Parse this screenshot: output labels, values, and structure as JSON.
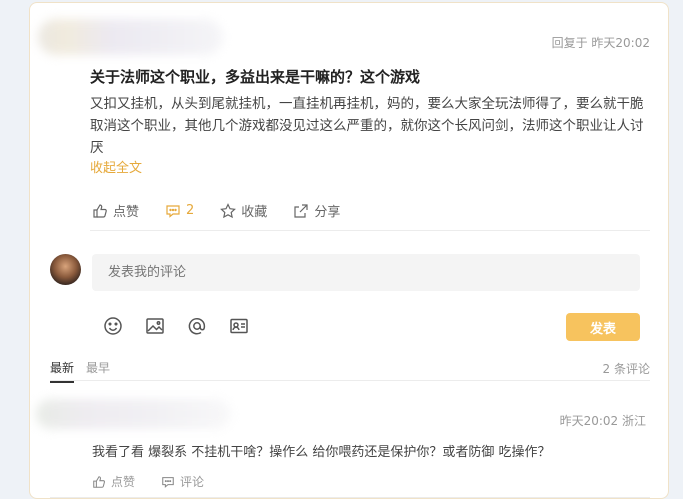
{
  "post": {
    "reply_meta": "回复于  昨天20:02",
    "title": "关于法师这个职业，多益出来是干嘛的？这个游戏",
    "body": "又扣又挂机，从头到尾就挂机，一直挂机再挂机，妈的，要么大家全玩法师得了，要么就干脆取消这个职业，其他几个游戏都没见过这么严重的，就你这个长风问剑，法师这个职业让人讨厌",
    "collapse_label": "收起全文",
    "actions": {
      "like": "点赞",
      "comment_count": "2",
      "favorite": "收藏",
      "share": "分享"
    }
  },
  "composer": {
    "placeholder": "发表我的评论",
    "submit_label": "发表",
    "tools": [
      "emoji-icon",
      "image-icon",
      "mention-icon",
      "card-icon"
    ]
  },
  "comments_header": {
    "tabs": [
      "最新",
      "最早"
    ],
    "active_tab": "最新",
    "count_label": "2 条评论"
  },
  "comments": [
    {
      "meta": "昨天20:02  浙江",
      "text": "我看了看 爆裂系 不挂机干啥？操作么 给你喂药还是保护你？或者防御 吃操作？",
      "like_label": "点赞",
      "reply_label": "评论"
    }
  ],
  "colors": {
    "accent": "#f7c35e",
    "link": "#e6a93b"
  }
}
